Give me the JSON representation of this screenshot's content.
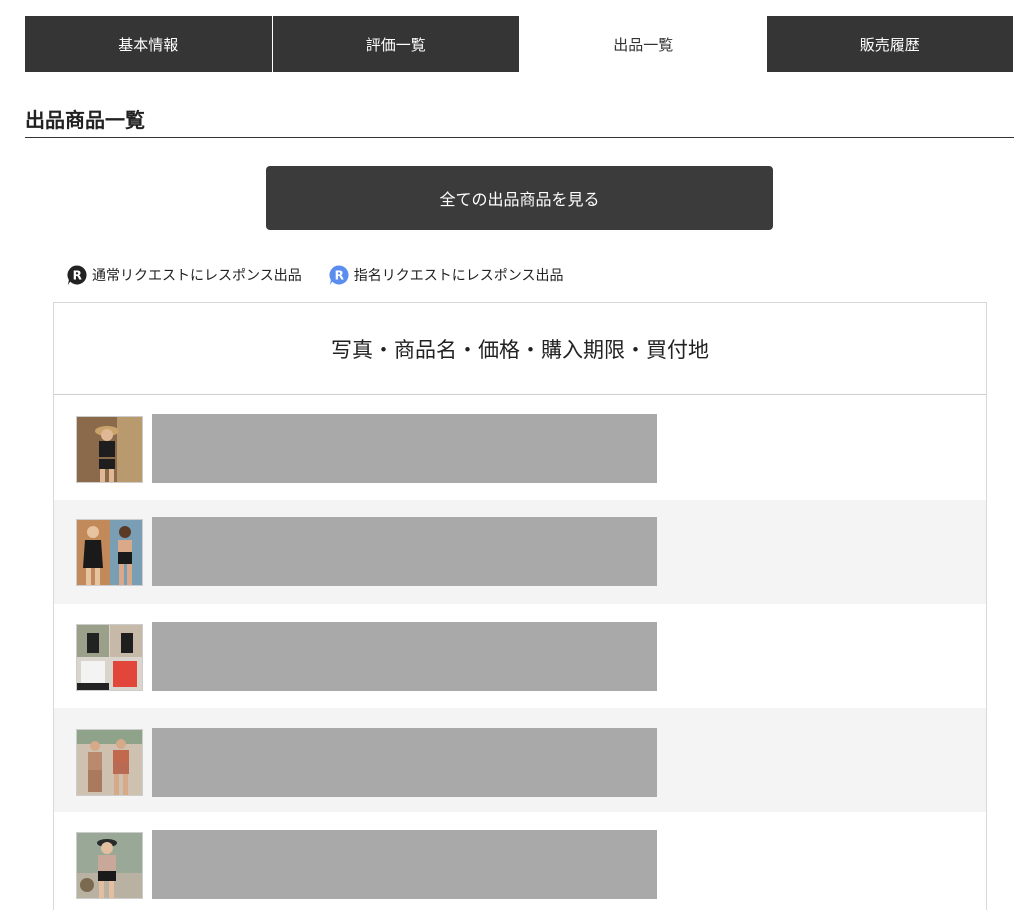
{
  "tabs": [
    {
      "label": "基本情報",
      "active": false
    },
    {
      "label": "評価一覧",
      "active": false
    },
    {
      "label": "出品一覧",
      "active": true
    },
    {
      "label": "販売履歴",
      "active": false
    }
  ],
  "section": {
    "title": "出品商品一覧"
  },
  "view_all_button": {
    "label": "全ての出品商品を見る"
  },
  "legend": {
    "normal": {
      "label": "通常リクエストにレスポンス出品",
      "badge_letter": "R",
      "color": "#222222"
    },
    "named": {
      "label": "指名リクエストにレスポンス出品",
      "badge_letter": "R",
      "color": "#5b8def"
    }
  },
  "list": {
    "header": "写真・商品名・価格・購入期限・買付地",
    "items": [
      {
        "thumbnail": "swimwear-photo"
      },
      {
        "thumbnail": "swimwear-photo"
      },
      {
        "thumbnail": "swimwear-photo"
      },
      {
        "thumbnail": "swimwear-photo"
      },
      {
        "thumbnail": "swimwear-photo"
      }
    ]
  }
}
